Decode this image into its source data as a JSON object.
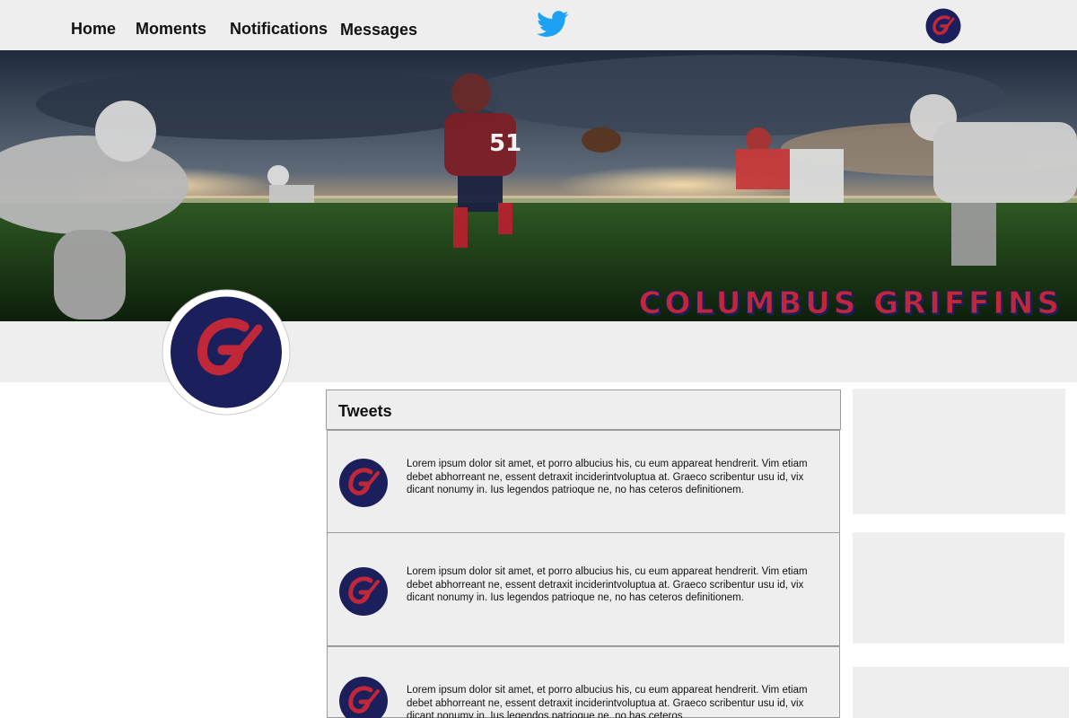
{
  "nav": {
    "items": [
      {
        "label": "Home"
      },
      {
        "label": "Moments"
      },
      {
        "label": "Notifications"
      },
      {
        "label": "Messages"
      }
    ],
    "logo_icon": "twitter-bird-icon"
  },
  "banner": {
    "title": "COLUMBUS GRIFFINS",
    "jersey_number": "51"
  },
  "profile": {
    "avatar_letter": "G"
  },
  "tweets": {
    "header": "Tweets",
    "items": [
      {
        "text": "Lorem ipsum dolor sit amet, et porro albucius his, cu eum appareat hendrerit. Vim etiam debet abhorreant ne, essent detraxit inciderintvoluptua at. Graeco scribentur usu id, vix dicant nonumy in. Ius legendos patrioque ne, no has ceteros definitionem."
      },
      {
        "text": "Lorem ipsum dolor sit amet, et porro albucius his, cu eum appareat hendrerit. Vim etiam debet abhorreant ne, essent detraxit inciderintvoluptua at. Graeco scribentur usu id, vix dicant nonumy in. Ius legendos patrioque ne, no has ceteros definitionem."
      },
      {
        "text": "Lorem ipsum dolor sit amet, et porro albucius his, cu eum appareat hendrerit. Vim etiam debet abhorreant ne, essent detraxit inciderintvoluptua at. Graeco scribentur usu id, vix dicant nonumy in. Ius legendos patrioque ne, no has ceteros"
      }
    ]
  },
  "colors": {
    "brand_blue": "#1b1f5c",
    "brand_red": "#c0283a",
    "twitter_blue": "#1da1f2",
    "panel_gray": "#eeeeee"
  }
}
